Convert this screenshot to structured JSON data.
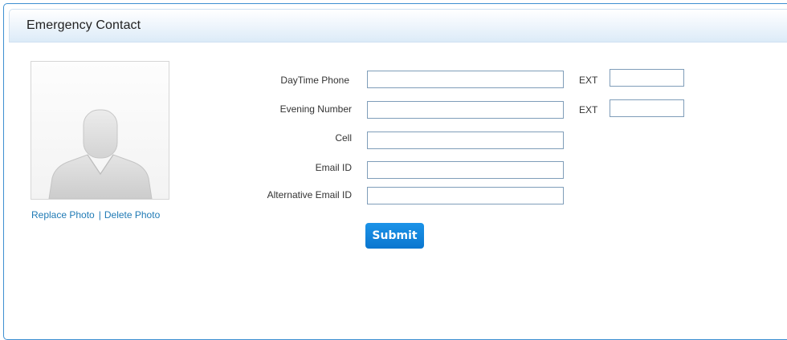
{
  "header": {
    "title": "Emergency Contact"
  },
  "photo": {
    "icon": "user-silhouette-icon",
    "replace_label": "Replace Photo",
    "separator": "|",
    "delete_label": "Delete Photo"
  },
  "form": {
    "daytime_phone": {
      "label": "DayTime Phone",
      "value": "",
      "ext_label": "EXT",
      "ext_value": ""
    },
    "evening_number": {
      "label": "Evening Number",
      "value": "",
      "ext_label": "EXT",
      "ext_value": ""
    },
    "cell": {
      "label": "Cell",
      "value": ""
    },
    "email": {
      "label": "Email ID",
      "value": ""
    },
    "alt_email": {
      "label": "Alternative Email ID",
      "value": ""
    },
    "submit_label": "Submit"
  },
  "colors": {
    "accent": "#0a76cf",
    "link": "#1f7ab5",
    "panel_border": "#3d8fd1",
    "input_border": "#7f9db9"
  }
}
